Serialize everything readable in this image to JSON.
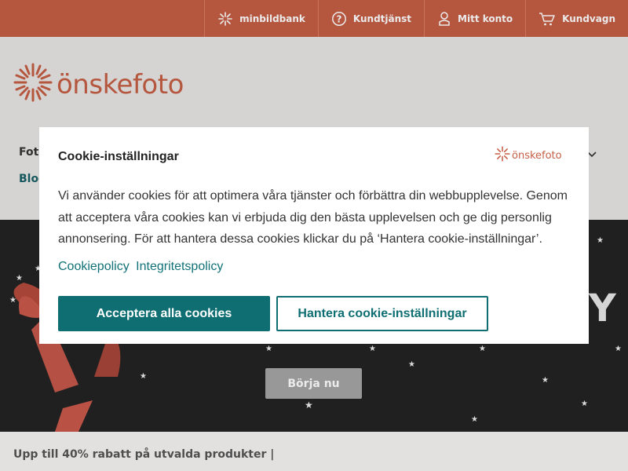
{
  "topnav": {
    "items": [
      {
        "label": "minbildbank",
        "icon": "sparkle-icon"
      },
      {
        "label": "Kundtjänst",
        "icon": "question-icon"
      },
      {
        "label": "Mitt konto",
        "icon": "user-icon"
      },
      {
        "label": "Kundvagn",
        "icon": "cart-icon"
      }
    ]
  },
  "header": {
    "logo_text": "önskefoto",
    "nav_item_1": "Foto",
    "nav_item_2": "Blog"
  },
  "hero": {
    "cta_label": "Börja nu"
  },
  "promo": {
    "text": "Upp till 40% rabatt på utvalda produkter |"
  },
  "cookie_modal": {
    "title": "Cookie-inställningar",
    "logo_text": "önskefoto",
    "body": "Vi använder cookies för att optimera våra tjänster och förbättra din webbupplevelse. Genom att acceptera våra cookies kan vi erbjuda dig den bästa upplevelsen och ge dig personlig annonsering. För att hantera dessa cookies klickar du på ‘Hantera cookie-inställningar’.",
    "link_cookiepolicy": "Cookiepolicy",
    "link_privacy": "Integritetspolicy",
    "accept_label": "Acceptera alla cookies",
    "manage_label": "Hantera cookie-inställningar"
  },
  "colors": {
    "brand": "#c55e45",
    "accent": "#0e6e72",
    "hero_bg": "#232323"
  }
}
